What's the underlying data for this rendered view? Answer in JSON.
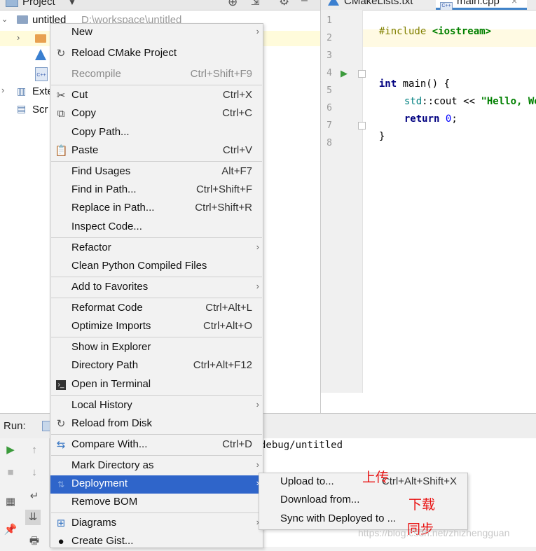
{
  "project_pane": {
    "header_title": "Project",
    "root_label": "untitled",
    "root_path": "D:\\workspace\\untitled",
    "tree_partials": [
      "Exte",
      "Scr"
    ]
  },
  "editor": {
    "tabs": [
      {
        "label": "CMakeLists.txt"
      },
      {
        "label": "main.cpp"
      }
    ],
    "line_numbers": [
      "1",
      "2",
      "3",
      "4",
      "5",
      "6",
      "7",
      "8"
    ],
    "code": {
      "l1_directive": "#include",
      "l1_header": "<iostream>",
      "l4_kw": "int",
      "l4_rest": " main() {",
      "l5_ns": "std",
      "l5_sep": "::",
      "l5_cout": "cout",
      "l5_op": " << ",
      "l5_str": "\"Hello, Wo",
      "l6_kw": "return",
      "l6_num": "0",
      "l6_semi": ";",
      "l7": "}"
    }
  },
  "run_panel": {
    "title": "Run:",
    "output_text": "debug/untitled"
  },
  "context_menu": {
    "items": [
      {
        "label": "New",
        "shortcut": "",
        "submenu": true
      },
      {
        "label": "Reload CMake Project",
        "shortcut": "",
        "submenu": false
      },
      {
        "label": "Recompile",
        "shortcut": "Ctrl+Shift+F9",
        "submenu": false,
        "disabled": true
      },
      {
        "label": "Cut",
        "shortcut": "Ctrl+X",
        "submenu": false
      },
      {
        "label": "Copy",
        "shortcut": "Ctrl+C",
        "submenu": false
      },
      {
        "label": "Copy Path...",
        "shortcut": "",
        "submenu": false
      },
      {
        "label": "Paste",
        "shortcut": "Ctrl+V",
        "submenu": false
      },
      {
        "label": "Find Usages",
        "shortcut": "Alt+F7",
        "submenu": false
      },
      {
        "label": "Find in Path...",
        "shortcut": "Ctrl+Shift+F",
        "submenu": false
      },
      {
        "label": "Replace in Path...",
        "shortcut": "Ctrl+Shift+R",
        "submenu": false
      },
      {
        "label": "Inspect Code...",
        "shortcut": "",
        "submenu": false
      },
      {
        "label": "Refactor",
        "shortcut": "",
        "submenu": true
      },
      {
        "label": "Clean Python Compiled Files",
        "shortcut": "",
        "submenu": false
      },
      {
        "label": "Add to Favorites",
        "shortcut": "",
        "submenu": true
      },
      {
        "label": "Reformat Code",
        "shortcut": "Ctrl+Alt+L",
        "submenu": false
      },
      {
        "label": "Optimize Imports",
        "shortcut": "Ctrl+Alt+O",
        "submenu": false
      },
      {
        "label": "Show in Explorer",
        "shortcut": "",
        "submenu": false
      },
      {
        "label": "Directory Path",
        "shortcut": "Ctrl+Alt+F12",
        "submenu": false
      },
      {
        "label": "Open in Terminal",
        "shortcut": "",
        "submenu": false
      },
      {
        "label": "Local History",
        "shortcut": "",
        "submenu": true
      },
      {
        "label": "Reload from Disk",
        "shortcut": "",
        "submenu": false
      },
      {
        "label": "Compare With...",
        "shortcut": "Ctrl+D",
        "submenu": false
      },
      {
        "label": "Mark Directory as",
        "shortcut": "",
        "submenu": true
      },
      {
        "label": "Deployment",
        "shortcut": "",
        "submenu": true,
        "active": true
      },
      {
        "label": "Remove BOM",
        "shortcut": "",
        "submenu": false
      },
      {
        "label": "Diagrams",
        "shortcut": "",
        "submenu": true
      },
      {
        "label": "Create Gist...",
        "shortcut": "",
        "submenu": false
      }
    ]
  },
  "deployment_submenu": {
    "items": [
      {
        "label": "Upload to...",
        "shortcut": "Ctrl+Alt+Shift+X"
      },
      {
        "label": "Download from...",
        "shortcut": ""
      },
      {
        "label": "Sync with Deployed to ...",
        "shortcut": ""
      }
    ]
  },
  "annotations": {
    "upload": "上传",
    "download": "下载",
    "sync": "同步"
  },
  "watermark": "https://blog.csdn.net/zhizhengguan",
  "colors": {
    "menu_highlight": "#2f65ca",
    "annotation_red": "#e81010",
    "keyword_navy": "#000080",
    "string_green": "#008000",
    "run_green": "#3c9b3c"
  }
}
